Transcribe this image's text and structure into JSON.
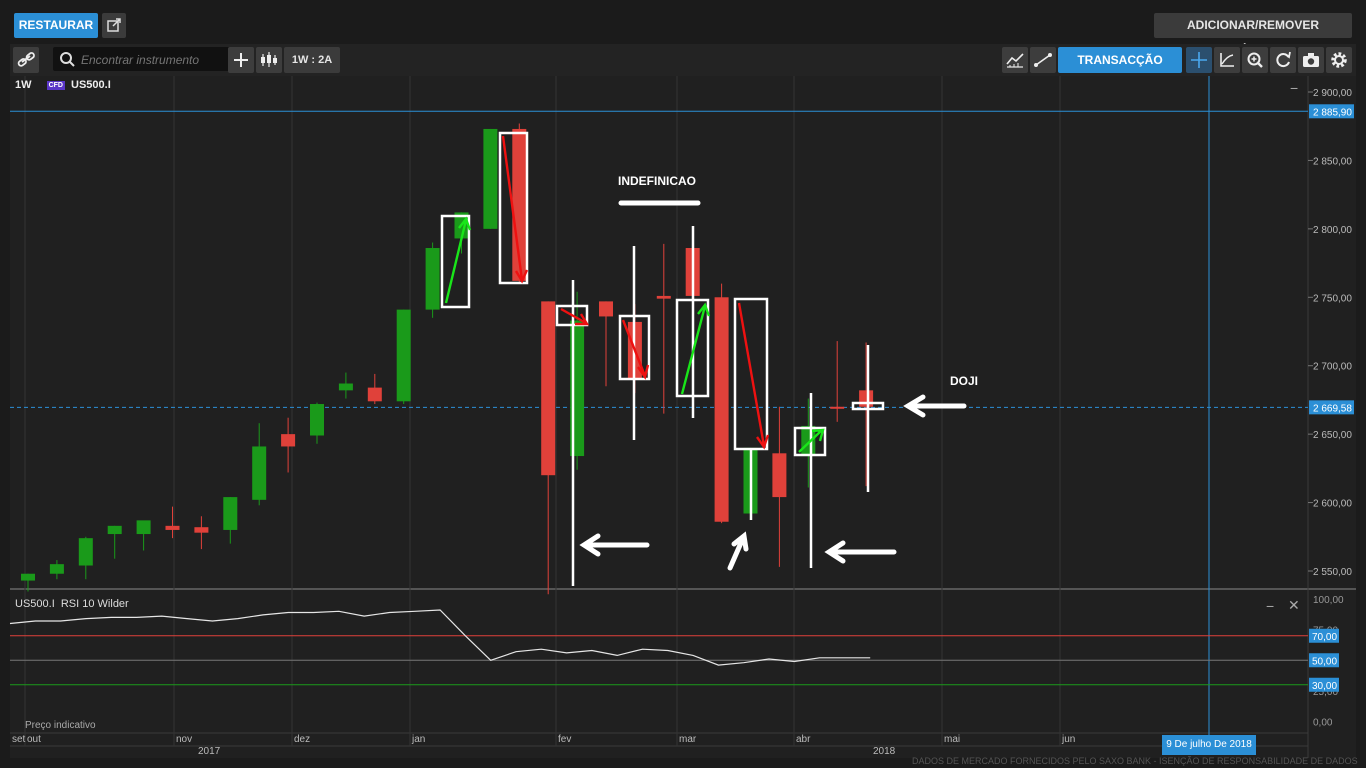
{
  "header": {
    "restore_label": "RESTAURAR",
    "add_remove_label": "ADICIONAR/REMOVER GRÁFICOS"
  },
  "toolbar": {
    "search_placeholder": "Encontrar instrumento",
    "period_label": "1W : 2A",
    "trade_label": "TRANSACÇÃO"
  },
  "chart_header": {
    "interval": "1W",
    "cfd_badge": "CFD",
    "instrument": "US500.I",
    "minimize": "−"
  },
  "chart_data": [
    {
      "type": "candlestick",
      "ylim": [
        2535,
        2910
      ],
      "y_ticks": [
        "2 900,00",
        "2 850,00",
        "2 800,00",
        "2 750,00",
        "2 700,00",
        "2 650,00",
        "2 600,00",
        "2 550,00"
      ],
      "y_tick_values": [
        2900,
        2850,
        2800,
        2750,
        2700,
        2650,
        2600,
        2550
      ],
      "last_price_label": "2 669,58",
      "last_price": 2669.58,
      "high_line_label": "2 885,90",
      "high_line": 2885.9,
      "candles": [
        {
          "o": 2543,
          "h": 2548,
          "l": 2535,
          "c": 2548
        },
        {
          "o": 2548,
          "h": 2558,
          "l": 2544,
          "c": 2555
        },
        {
          "o": 2554,
          "h": 2575,
          "l": 2544,
          "c": 2574
        },
        {
          "o": 2577,
          "h": 2583,
          "l": 2559,
          "c": 2583
        },
        {
          "o": 2577,
          "h": 2586,
          "l": 2565,
          "c": 2587
        },
        {
          "o": 2583,
          "h": 2597,
          "l": 2574,
          "c": 2580
        },
        {
          "o": 2582,
          "h": 2590,
          "l": 2566,
          "c": 2578
        },
        {
          "o": 2580,
          "h": 2604,
          "l": 2570,
          "c": 2604
        },
        {
          "o": 2602,
          "h": 2658,
          "l": 2598,
          "c": 2641
        },
        {
          "o": 2650,
          "h": 2662,
          "l": 2622,
          "c": 2641
        },
        {
          "o": 2649,
          "h": 2673,
          "l": 2643,
          "c": 2672
        },
        {
          "o": 2682,
          "h": 2695,
          "l": 2676,
          "c": 2687
        },
        {
          "o": 2684,
          "h": 2694,
          "l": 2672,
          "c": 2674
        },
        {
          "o": 2674,
          "h": 2741,
          "l": 2672,
          "c": 2741
        },
        {
          "o": 2741,
          "h": 2790,
          "l": 2735,
          "c": 2786
        },
        {
          "o": 2793,
          "h": 2812,
          "l": 2782,
          "c": 2812
        },
        {
          "o": 2800,
          "h": 2873,
          "l": 2800,
          "c": 2873
        },
        {
          "o": 2873,
          "h": 2877,
          "l": 2761,
          "c": 2762
        },
        {
          "o": 2747,
          "h": 2747,
          "l": 2533,
          "c": 2620
        },
        {
          "o": 2634,
          "h": 2754,
          "l": 2624,
          "c": 2733
        },
        {
          "o": 2747,
          "h": 2747,
          "l": 2685,
          "c": 2736
        },
        {
          "o": 2732,
          "h": 2745,
          "l": 2680,
          "c": 2690
        },
        {
          "o": 2751,
          "h": 2789,
          "l": 2665,
          "c": 2749
        },
        {
          "o": 2786,
          "h": 2801,
          "l": 2670,
          "c": 2751
        },
        {
          "o": 2750,
          "h": 2760,
          "l": 2585,
          "c": 2586
        },
        {
          "o": 2592,
          "h": 2640,
          "l": 2588,
          "c": 2640
        },
        {
          "o": 2636,
          "h": 2670,
          "l": 2553,
          "c": 2604
        },
        {
          "o": 2634,
          "h": 2676,
          "l": 2611,
          "c": 2656
        },
        {
          "o": 2670,
          "h": 2718,
          "l": 2659,
          "c": 2669
        },
        {
          "o": 2682,
          "h": 2717,
          "l": 2612,
          "c": 2670
        }
      ],
      "x_month_labels": [
        "set",
        "out",
        "nov",
        "dez",
        "jan",
        "fev",
        "mar",
        "abr",
        "mai",
        "jun"
      ],
      "x_year_labels": [
        "2017",
        "2018"
      ],
      "crosshair_date": "9 De julho De 2018",
      "annotations": [
        "INDEFINICAO",
        "DOJI"
      ]
    },
    {
      "type": "line",
      "title": "US500.I  RSI 10 Wilder",
      "ylim": [
        0,
        100
      ],
      "y_ticks": [
        "100,00",
        "75,00",
        "50,00",
        "25,00",
        "0,00"
      ],
      "y_tick_values": [
        100,
        75,
        50,
        25,
        0
      ],
      "levels": [
        70,
        50,
        30
      ],
      "level_labels": [
        "70,00",
        "50,00",
        "30,00"
      ],
      "values": [
        80,
        82,
        82,
        84,
        85,
        85,
        86,
        84,
        82,
        84,
        87,
        89,
        89,
        90,
        86,
        89,
        90,
        91,
        70,
        50,
        57,
        59,
        56,
        58,
        54,
        59,
        58,
        54,
        46,
        48,
        51,
        49,
        52,
        52,
        52
      ],
      "footer_note": "Preço indicativo"
    }
  ],
  "watermark": "DADOS DE MERCADO FORNECIDOS PELO SAXO BANK - ISENÇÃO DE RESPONSABILIDADE DE DADOS",
  "colors": {
    "up": "#1a9a1a",
    "down": "#e0413a",
    "accent": "#2b8fd6",
    "background": "#202020"
  }
}
